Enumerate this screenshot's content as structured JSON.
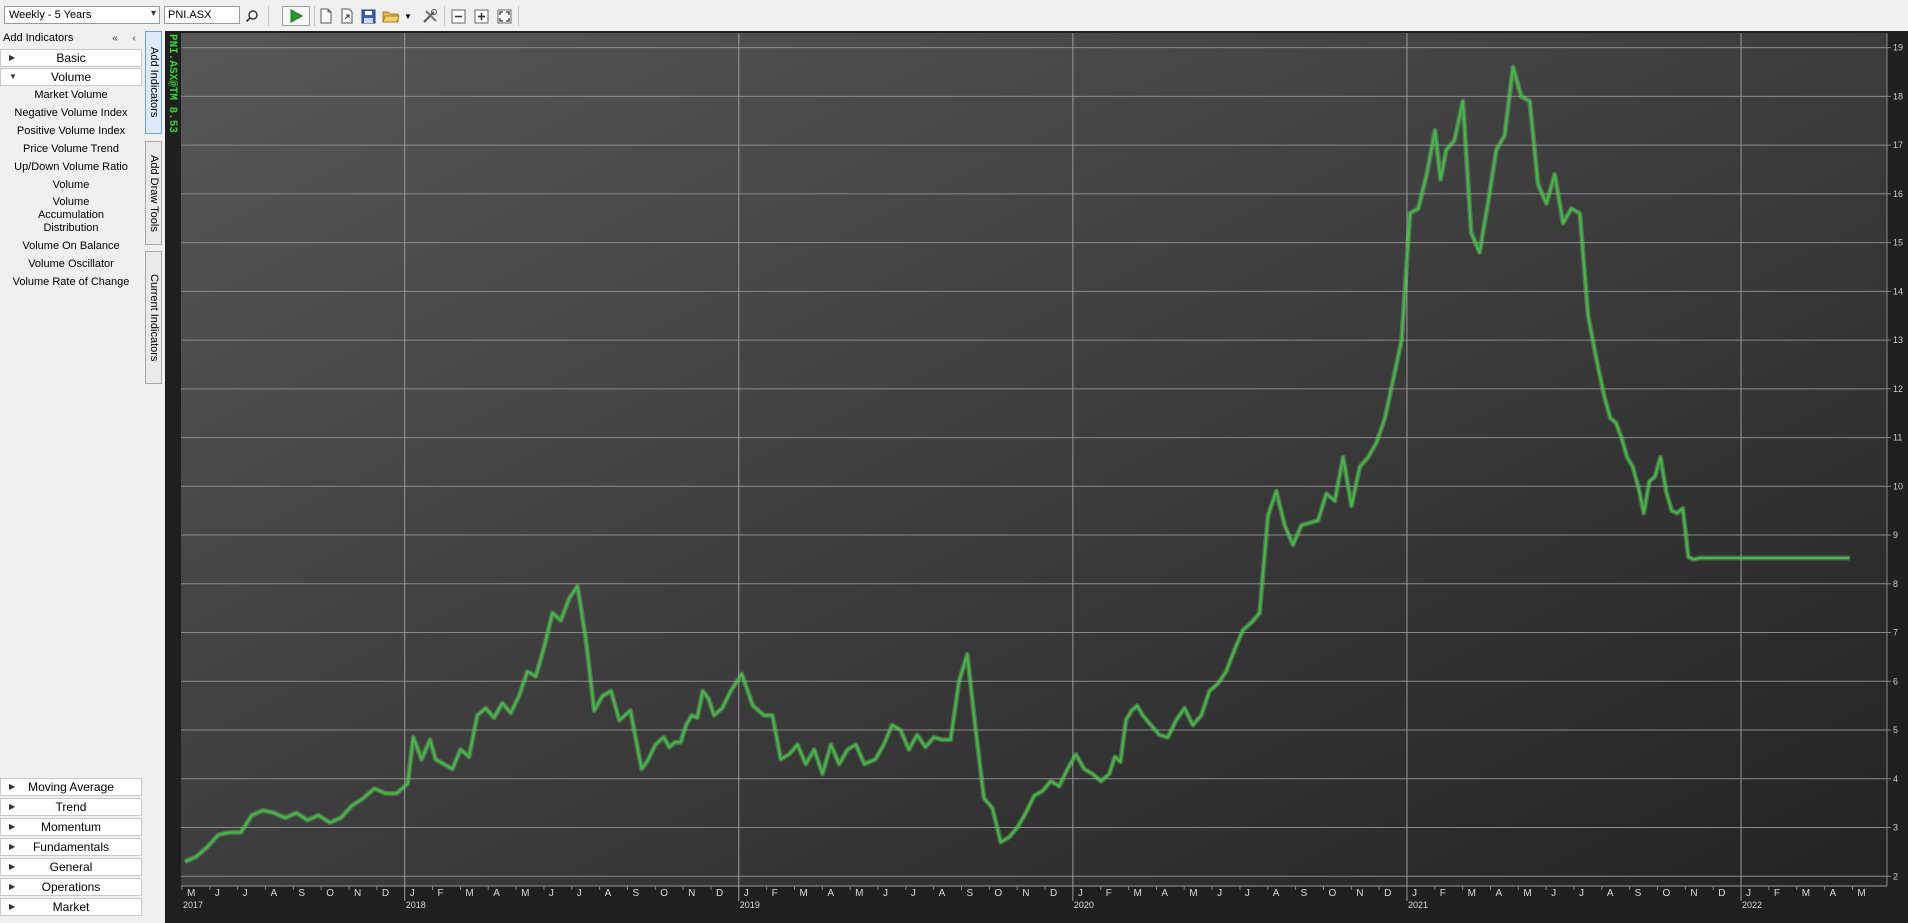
{
  "toolbar": {
    "period_select": "Weekly - 5 Years",
    "symbol": "PNI.ASX",
    "icons": [
      "search-icon",
      "play-icon",
      "new-document-icon",
      "export-icon",
      "save-icon",
      "open-folder-icon",
      "dropdown-arrow-icon",
      "tools-icon",
      "zoom-out-icon",
      "zoom-in-icon",
      "fit-to-window-icon"
    ]
  },
  "left_panel": {
    "header": "Add Indicators",
    "collapse_all_icon": "double-left-arrow-icon",
    "collapse_icon": "left-arrow-icon",
    "top_categories": [
      {
        "label": "Basic",
        "expanded": false
      },
      {
        "label": "Volume",
        "expanded": true
      }
    ],
    "volume_items": [
      "Market Volume",
      "Negative Volume Index",
      "Positive Volume Index",
      "Price Volume Trend",
      "Up/Down Volume Ratio",
      "Volume",
      "Volume Accumulation Distribution",
      "Volume On Balance",
      "Volume Oscillator",
      "Volume Rate of Change"
    ],
    "bottom_categories": [
      "Moving Average",
      "Trend",
      "Momentum",
      "Fundamentals",
      "General",
      "Operations",
      "Market"
    ]
  },
  "side_tabs": [
    "Add Indicators",
    "Add Draw Tools",
    "Current Indicators"
  ],
  "chart_title": "PNI.ASX@TM 8.53",
  "colors": {
    "line": "#3fbf3f",
    "line_glow": "#7fe07f",
    "title": "#37d437",
    "background_top": "#545454",
    "background_bottom": "#262626"
  },
  "chart_data": {
    "type": "line",
    "title": "PNI.ASX@TM 8.53",
    "xlabel": "",
    "ylabel": "",
    "ylim": [
      1.8,
      19.3
    ],
    "y_ticks": [
      2,
      3,
      4,
      5,
      6,
      7,
      8,
      9,
      10,
      11,
      12,
      13,
      14,
      15,
      16,
      17,
      18,
      19
    ],
    "grid": true,
    "months": [
      "M",
      "J",
      "J",
      "A",
      "S",
      "O",
      "N",
      "D",
      "J",
      "F",
      "M",
      "A",
      "M",
      "J",
      "J",
      "A",
      "S",
      "O",
      "N",
      "D",
      "J",
      "F",
      "M",
      "A",
      "M",
      "J",
      "J",
      "A",
      "S",
      "O",
      "N",
      "D",
      "J",
      "F",
      "M",
      "A",
      "M",
      "J",
      "J",
      "A",
      "S",
      "O",
      "N",
      "D",
      "J",
      "F",
      "M",
      "A",
      "M",
      "J",
      "J",
      "A",
      "S",
      "O",
      "N",
      "D",
      "J",
      "F",
      "M",
      "A",
      "M"
    ],
    "years": [
      {
        "label": "2017",
        "month_index": 0
      },
      {
        "label": "2018",
        "month_index": 8
      },
      {
        "label": "2019",
        "month_index": 20
      },
      {
        "label": "2020",
        "month_index": 32
      },
      {
        "label": "2021",
        "month_index": 44
      },
      {
        "label": "2022",
        "month_index": 56
      }
    ],
    "series": [
      {
        "name": "",
        "x_months": [
          0,
          0.4,
          0.8,
          1.2,
          1.6,
          2.0,
          2.4,
          2.8,
          3.2,
          3.6,
          4.0,
          4.4,
          4.8,
          5.2,
          5.6,
          6.0,
          6.4,
          6.8,
          7.2,
          7.6,
          8.0,
          8.2,
          8.5,
          8.8,
          9.0,
          9.3,
          9.6,
          9.9,
          10.2,
          10.5,
          10.8,
          11.1,
          11.4,
          11.7,
          12.0,
          12.3,
          12.6,
          12.9,
          13.2,
          13.5,
          13.8,
          14.1,
          14.4,
          14.7,
          15.0,
          15.3,
          15.6,
          16.0,
          16.4,
          16.6,
          16.9,
          17.2,
          17.4,
          17.6,
          17.8,
          18.0,
          18.2,
          18.4,
          18.6,
          18.8,
          19.0,
          19.3,
          19.6,
          20.0,
          20.4,
          20.8,
          21.1,
          21.4,
          21.7,
          22.0,
          22.3,
          22.6,
          22.9,
          23.2,
          23.5,
          23.8,
          24.1,
          24.4,
          24.8,
          25.1,
          25.4,
          25.7,
          26.0,
          26.3,
          26.6,
          26.9,
          27.2,
          27.5,
          27.8,
          28.1,
          28.4,
          28.7,
          29.0,
          29.3,
          29.6,
          29.9,
          30.2,
          30.5,
          30.8,
          31.1,
          31.4,
          31.7,
          32.0,
          32.3,
          32.6,
          32.9,
          33.2,
          33.4,
          33.6,
          33.8,
          34.0,
          34.2,
          34.4,
          34.7,
          35.0,
          35.3,
          35.6,
          35.9,
          36.2,
          36.5,
          36.8,
          37.1,
          37.4,
          37.7,
          38.0,
          38.3,
          38.6,
          38.9,
          39.2,
          39.5,
          39.8,
          40.1,
          40.4,
          40.7,
          41.0,
          41.3,
          41.6,
          41.9,
          42.2,
          42.5,
          42.8,
          43.1,
          43.4,
          43.7,
          44.0,
          44.3,
          44.6,
          44.9,
          45.1,
          45.3,
          45.6,
          45.9,
          46.2,
          46.5,
          46.8,
          47.1,
          47.4,
          47.7,
          48.0,
          48.3,
          48.6,
          48.9,
          49.2,
          49.5,
          49.8,
          50.1,
          50.4,
          50.7,
          51.0,
          51.2,
          51.4,
          51.6,
          51.8,
          52.0,
          52.2,
          52.4,
          52.6,
          52.8,
          53.0,
          53.2,
          53.4,
          53.6,
          53.8,
          54.0,
          54.2,
          54.4,
          54.6,
          54.8,
          55.0,
          55.2,
          55.4,
          55.6,
          55.8,
          56.0,
          56.2,
          56.4,
          56.6,
          56.8,
          57.0,
          57.2,
          57.4,
          57.6,
          57.8,
          58.0,
          58.2,
          58.4,
          58.6,
          58.8,
          59.0,
          59.2,
          59.4,
          59.6,
          59.8,
          60.0,
          60.2,
          60.4
        ],
        "values": [
          2.3,
          2.4,
          2.6,
          2.85,
          2.9,
          2.9,
          3.25,
          3.35,
          3.3,
          3.2,
          3.3,
          3.15,
          3.25,
          3.1,
          3.2,
          3.45,
          3.6,
          3.8,
          3.7,
          3.7,
          3.9,
          4.85,
          4.4,
          4.8,
          4.4,
          4.3,
          4.2,
          4.6,
          4.45,
          5.3,
          5.45,
          5.25,
          5.55,
          5.35,
          5.7,
          6.2,
          6.1,
          6.7,
          7.4,
          7.25,
          7.7,
          7.95,
          6.85,
          5.4,
          5.7,
          5.8,
          5.2,
          5.4,
          4.2,
          4.35,
          4.7,
          4.85,
          4.65,
          4.75,
          4.75,
          5.1,
          5.3,
          5.25,
          5.8,
          5.65,
          5.3,
          5.45,
          5.8,
          6.15,
          5.5,
          5.3,
          5.3,
          4.4,
          4.5,
          4.7,
          4.3,
          4.6,
          4.1,
          4.7,
          4.3,
          4.6,
          4.7,
          4.3,
          4.4,
          4.7,
          5.1,
          5.0,
          4.6,
          4.9,
          4.65,
          4.85,
          4.8,
          4.8,
          6.0,
          6.55,
          5.0,
          3.6,
          3.4,
          2.7,
          2.8,
          3.0,
          3.3,
          3.65,
          3.75,
          3.95,
          3.85,
          4.2,
          4.5,
          4.2,
          4.1,
          3.95,
          4.1,
          4.45,
          4.35,
          5.2,
          5.4,
          5.5,
          5.3,
          5.1,
          4.9,
          4.85,
          5.2,
          5.45,
          5.1,
          5.3,
          5.8,
          5.95,
          6.2,
          6.65,
          7.05,
          7.2,
          7.4,
          9.4,
          9.9,
          9.2,
          8.8,
          9.2,
          9.25,
          9.3,
          9.85,
          9.7,
          10.6,
          9.6,
          10.4,
          10.6,
          10.9,
          11.4,
          12.2,
          13.0,
          15.6,
          15.7,
          16.4,
          17.3,
          16.3,
          16.9,
          17.1,
          17.9,
          15.2,
          14.8,
          15.8,
          16.9,
          17.2,
          18.6,
          18.0,
          17.9,
          16.2,
          15.8,
          16.4,
          15.4,
          15.7,
          15.6,
          13.5,
          12.6,
          11.8,
          11.4,
          11.3,
          11.0,
          10.6,
          10.4,
          10.0,
          9.45,
          10.1,
          10.2,
          10.6,
          9.9,
          9.5,
          9.45,
          9.55,
          8.55,
          8.5,
          8.53,
          8.53,
          8.53,
          8.53,
          8.53,
          8.53,
          8.53,
          8.53,
          8.53,
          8.53,
          8.53,
          8.53,
          8.53,
          8.53,
          8.53,
          8.53,
          8.53,
          8.53,
          8.53,
          8.53,
          8.53,
          8.53,
          8.53,
          8.53,
          8.53,
          8.53,
          8.53,
          8.53
        ]
      }
    ]
  }
}
